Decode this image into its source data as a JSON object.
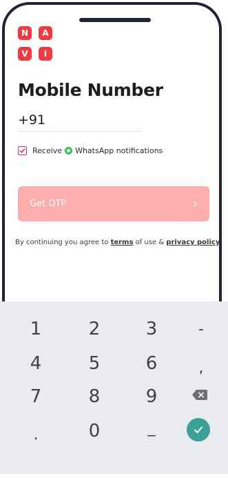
{
  "app": {
    "logo_letters": [
      "N",
      "A",
      "V",
      "I"
    ]
  },
  "header": {
    "title": "Mobile Number"
  },
  "phone_input": {
    "prefix": "+91",
    "value": ""
  },
  "whatsapp_opt_in": {
    "checked": true,
    "text_before": "Receive",
    "text_after": "WhatsApp notifications"
  },
  "primary_action": {
    "label": "Get OTP",
    "enabled": false
  },
  "terms": {
    "text_prefix": "By continuing you agree to ",
    "terms_link": "terms",
    "text_middle": " of use & ",
    "privacy_link": "privacy policy"
  },
  "keypad": {
    "rows": [
      [
        "1",
        "2",
        "3",
        "-"
      ],
      [
        "4",
        "5",
        "6",
        ","
      ],
      [
        "7",
        "8",
        "9",
        "⌫"
      ],
      [
        ".",
        "0",
        "_",
        "✓"
      ]
    ]
  },
  "colors": {
    "accent": "#f2393f",
    "button_disabled": "#fcaeae",
    "keypad_bg": "#e9ebee",
    "done_key": "#3aa197",
    "whatsapp_green": "#30c352",
    "frame": "#1f2336"
  }
}
